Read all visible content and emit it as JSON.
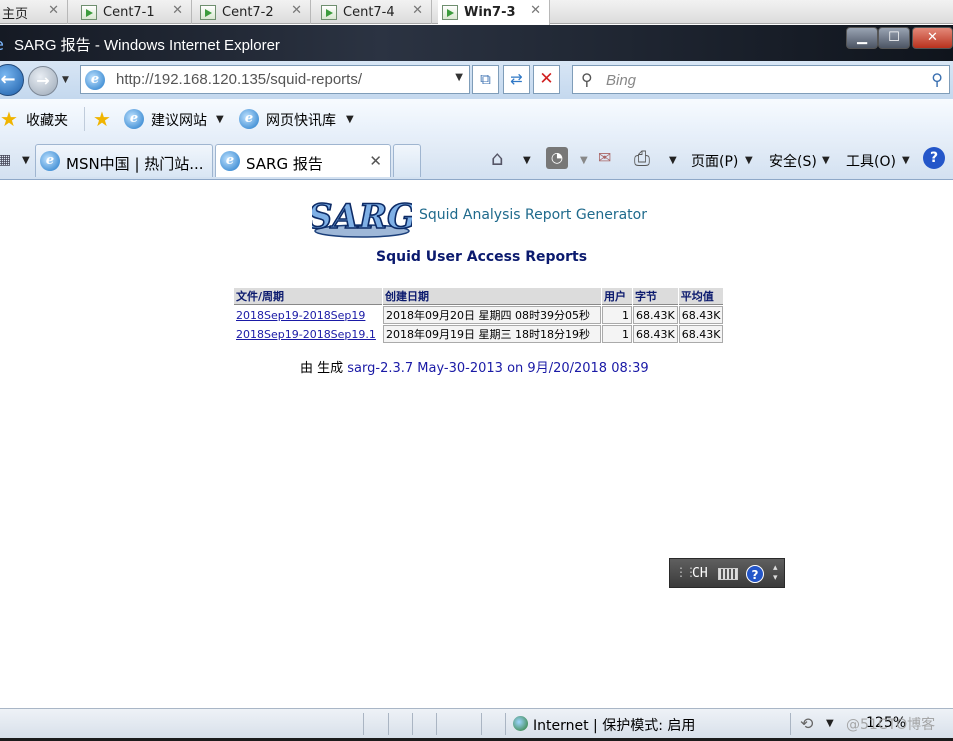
{
  "vm_tabs": [
    {
      "label": "主页"
    },
    {
      "label": "Cent7-1"
    },
    {
      "label": "Cent7-2"
    },
    {
      "label": "Cent7-4"
    },
    {
      "label": "Win7-3",
      "active": true
    }
  ],
  "window": {
    "title": "SARG 报告 - Windows Internet Explorer"
  },
  "address": {
    "url": "http://192.168.120.135/squid-reports/",
    "search_placeholder": "Bing"
  },
  "favorites": {
    "favorites_label": "收藏夹",
    "suggested_sites": "建议网站",
    "web_slice": "网页快讯库"
  },
  "tabs": [
    {
      "label": "MSN中国 | 热门站...",
      "active": false
    },
    {
      "label": "SARG 报告",
      "active": true
    }
  ],
  "command_bar": {
    "page": "页面(P)",
    "safety": "安全(S)",
    "tools": "工具(O)"
  },
  "report": {
    "logo_text": "SARG",
    "logo_subtitle": "Squid Analysis Report Generator",
    "title": "Squid User Access Reports",
    "columns": [
      "文件/周期",
      "创建日期",
      "用户",
      "字节",
      "平均值"
    ],
    "rows": [
      {
        "period": "2018Sep19-2018Sep19",
        "created": "2018年09月20日 星期四 08时39分05秒",
        "users": "1",
        "bytes": "68.43K",
        "average": "68.43K"
      },
      {
        "period": "2018Sep19-2018Sep19.1",
        "created": "2018年09月19日 星期三 18时18分19秒",
        "users": "1",
        "bytes": "68.43K",
        "average": "68.43K"
      }
    ],
    "generated_prefix": "由 生成",
    "generator": "sarg-2.3.7 May-30-2013",
    "generated_suffix": "on 9月/20/2018 08:39"
  },
  "langbar": {
    "lang": "CH"
  },
  "statusbar": {
    "zone": "Internet | 保护模式: 启用",
    "zoom": "125%",
    "watermark": "@51CTO博客"
  },
  "colors": {
    "link": "#1a1aa6",
    "report_title": "#0b1a6e",
    "logo_subtitle": "#1f6a8c"
  }
}
